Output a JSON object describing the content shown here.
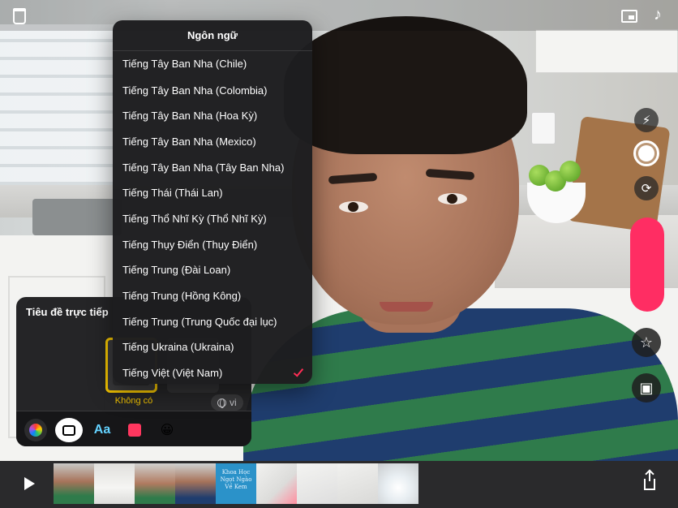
{
  "language_menu": {
    "title": "Ngôn ngữ",
    "items": [
      {
        "label": "Tiếng Tây Ban Nha (Chile)",
        "selected": false
      },
      {
        "label": "Tiếng Tây Ban Nha (Colombia)",
        "selected": false
      },
      {
        "label": "Tiếng Tây Ban Nha (Hoa Kỳ)",
        "selected": false
      },
      {
        "label": "Tiếng Tây Ban Nha (Mexico)",
        "selected": false
      },
      {
        "label": "Tiếng Tây Ban Nha (Tây Ban Nha)",
        "selected": false
      },
      {
        "label": "Tiếng Thái (Thái Lan)",
        "selected": false
      },
      {
        "label": "Tiếng Thổ Nhĩ Kỳ (Thổ Nhĩ Kỳ)",
        "selected": false
      },
      {
        "label": "Tiếng Thụy Điển (Thụy Điển)",
        "selected": false
      },
      {
        "label": "Tiếng Trung (Đài Loan)",
        "selected": false
      },
      {
        "label": "Tiếng Trung (Hồng Kông)",
        "selected": false
      },
      {
        "label": "Tiếng Trung (Trung Quốc đại lục)",
        "selected": false
      },
      {
        "label": "Tiếng Ukraina (Ukraina)",
        "selected": false
      },
      {
        "label": "Tiếng Việt (Việt Nam)",
        "selected": true
      }
    ]
  },
  "live_titles": {
    "title": "Tiêu đề trực tiếp",
    "style_label": "Không có",
    "language_code": "vi"
  },
  "toolbar": {
    "text_tool_label": "Aa",
    "emoji": "😀"
  },
  "timeline": {
    "title_card_text": "Khoa Học Ngọt Ngào Về Kem"
  },
  "icons": {
    "top_left": "trash-icon",
    "top_right": [
      "screen-icon",
      "music-icon"
    ],
    "right_controls": [
      "flash-icon",
      "shutter-icon",
      "flip-camera-icon",
      "record-button",
      "effects-star-icon",
      "photo-library-icon"
    ],
    "bottom": [
      "play-icon",
      "share-icon"
    ]
  },
  "colors": {
    "record": "#ff2d63",
    "accent_yellow": "#f2c300",
    "checkmark": "#ff2d55",
    "text_tool": "#64d2ff"
  }
}
